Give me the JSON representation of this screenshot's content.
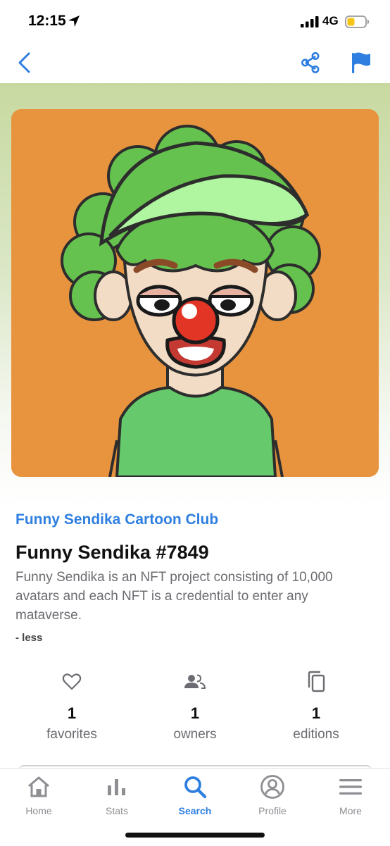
{
  "status_bar": {
    "time": "12:15",
    "network": "4G",
    "icons": [
      "location-arrow-icon",
      "signal-bars-icon",
      "battery-icon"
    ]
  },
  "nav": {
    "icons": [
      "chevron-left-icon",
      "share-icon",
      "flag-icon"
    ],
    "accent_color": "#2f7fe0"
  },
  "nft": {
    "collection": "Funny Sendika Cartoon Club",
    "title": "Funny Sendika #7849",
    "description": "Funny Sendika is an NFT project consisting of 10,000 avatars and each NFT is a credential to enter any mataverse.",
    "toggle_label": "- less",
    "artwork_background": "#e8943e"
  },
  "stats": [
    {
      "value": "1",
      "label": "favorites",
      "icon": "heart-icon"
    },
    {
      "value": "1",
      "label": "owners",
      "icon": "people-icon"
    },
    {
      "value": "1",
      "label": "editions",
      "icon": "copy-icon"
    }
  ],
  "tabs": [
    {
      "label": "Home",
      "icon": "home-icon",
      "active": false
    },
    {
      "label": "Stats",
      "icon": "bar-chart-icon",
      "active": false
    },
    {
      "label": "Search",
      "icon": "search-icon",
      "active": true
    },
    {
      "label": "Profile",
      "icon": "profile-icon",
      "active": false
    },
    {
      "label": "More",
      "icon": "menu-icon",
      "active": false
    }
  ]
}
